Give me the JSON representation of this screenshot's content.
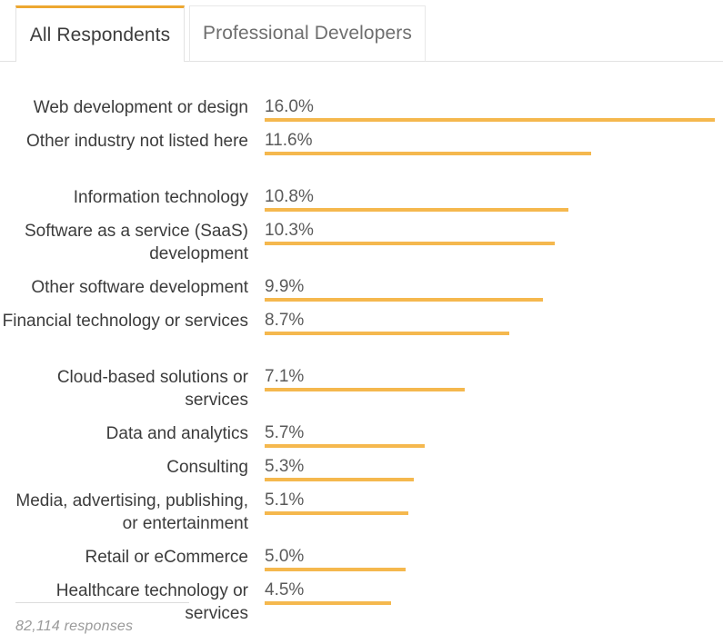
{
  "tabs": [
    {
      "label": "All Respondents",
      "active": true
    },
    {
      "label": "Professional Developers",
      "active": false
    }
  ],
  "footer": {
    "responses_note": "82,114 responses"
  },
  "colors": {
    "bar": "#f5b84e",
    "tab_active_accent": "#eda730",
    "label_text": "#3c3c3c",
    "value_text": "#5a5a5a",
    "footer_text": "#9a9a9a",
    "border": "#e2e2e2"
  },
  "chart_data": {
    "type": "bar",
    "orientation": "horizontal",
    "title": "",
    "subtitle": "",
    "xlabel": "",
    "ylabel": "",
    "grid": false,
    "legend": "none",
    "value_suffix": "%",
    "xlim": [
      0,
      16.0
    ],
    "categories": [
      "Web development or design",
      "Other industry not listed here",
      "Information technology",
      "Software as a service (SaaS) development",
      "Other software development",
      "Financial technology or services",
      "Cloud-based solutions or services",
      "Data and analytics",
      "Consulting",
      "Media, advertising, publishing, or entertainment",
      "Retail or eCommerce",
      "Healthcare technology or services"
    ],
    "values": [
      16.0,
      11.6,
      10.8,
      10.3,
      9.9,
      8.7,
      7.1,
      5.7,
      5.3,
      5.1,
      5.0,
      4.5
    ],
    "value_labels": [
      "16.0%",
      "11.6%",
      "10.8%",
      "10.3%",
      "9.9%",
      "8.7%",
      "7.1%",
      "5.7%",
      "5.3%",
      "5.1%",
      "5.0%",
      "4.5%"
    ]
  }
}
